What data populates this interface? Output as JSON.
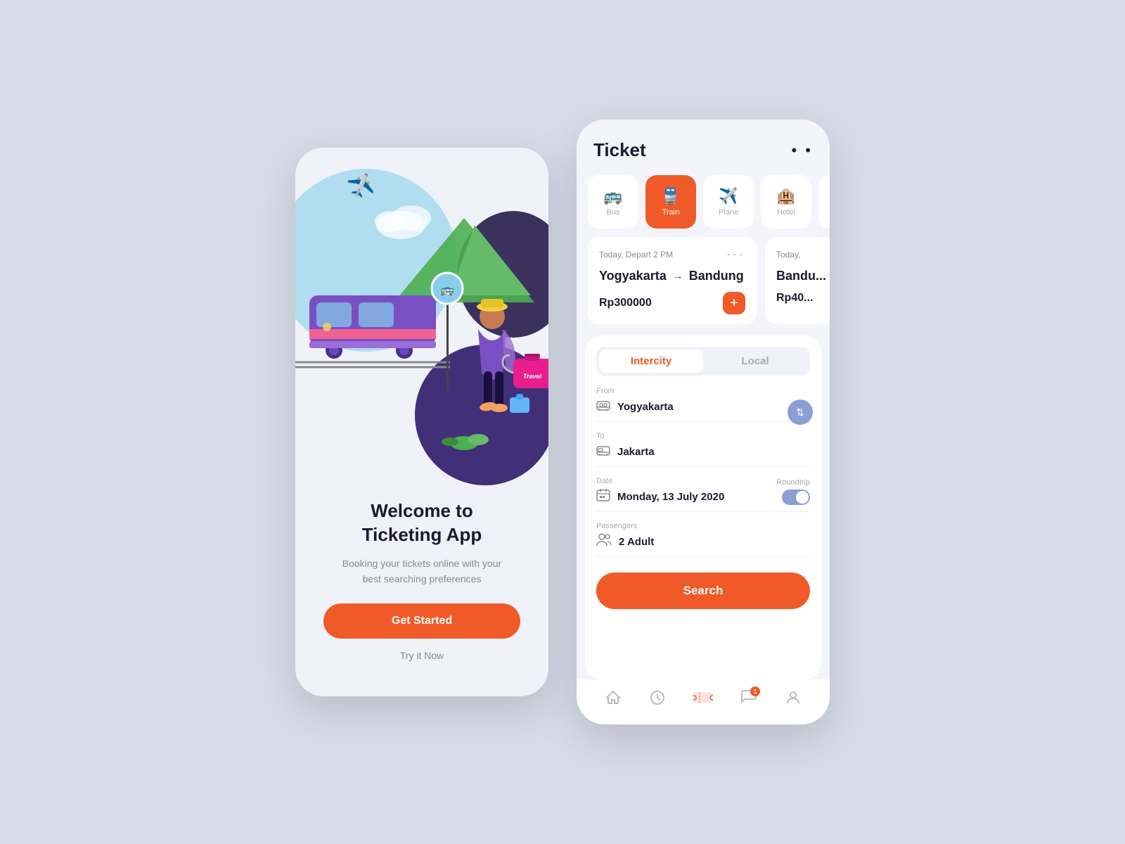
{
  "welcome_screen": {
    "title": "Welcome to\nTicketing App",
    "subtitle": "Booking your tickets online with your best searching preferences",
    "btn_get_started": "Get Started",
    "try_now": "Try it Now"
  },
  "ticket_screen": {
    "title": "Ticket",
    "transport_tabs": [
      {
        "id": "bus",
        "label": "Bus",
        "icon": "🚌",
        "active": false
      },
      {
        "id": "train",
        "label": "Train",
        "icon": "🚆",
        "active": true
      },
      {
        "id": "plane",
        "label": "Plane",
        "icon": "✈️",
        "active": false
      },
      {
        "id": "hotel",
        "label": "Hotel",
        "icon": "🏨",
        "active": false
      }
    ],
    "ticket_cards": [
      {
        "depart": "Today, Depart 2 PM",
        "from": "Yogyakarta",
        "to": "Bandung",
        "price": "Rp300000"
      },
      {
        "depart": "Today,",
        "from": "Bandung",
        "to": "...",
        "price": "Rp40..."
      }
    ],
    "segment_tabs": [
      {
        "label": "Intercity",
        "active": true
      },
      {
        "label": "Local",
        "active": false
      }
    ],
    "form": {
      "from_label": "From",
      "from_value": "Yogyakarta",
      "to_label": "To",
      "to_value": "Jakarta",
      "date_label": "Date",
      "date_value": "Monday, 13 July 2020",
      "roundtrip_label": "Roundtrip",
      "passengers_label": "Passengers",
      "passengers_value": "2 Adult"
    },
    "search_btn": "Search",
    "bottom_nav": [
      {
        "id": "home",
        "icon": "🏠",
        "active": false
      },
      {
        "id": "history",
        "icon": "🕐",
        "active": false
      },
      {
        "id": "ticket",
        "icon": "🎟",
        "active": true
      },
      {
        "id": "chat",
        "icon": "💬",
        "active": false,
        "badge": "1"
      },
      {
        "id": "profile",
        "icon": "👤",
        "active": false
      }
    ]
  }
}
